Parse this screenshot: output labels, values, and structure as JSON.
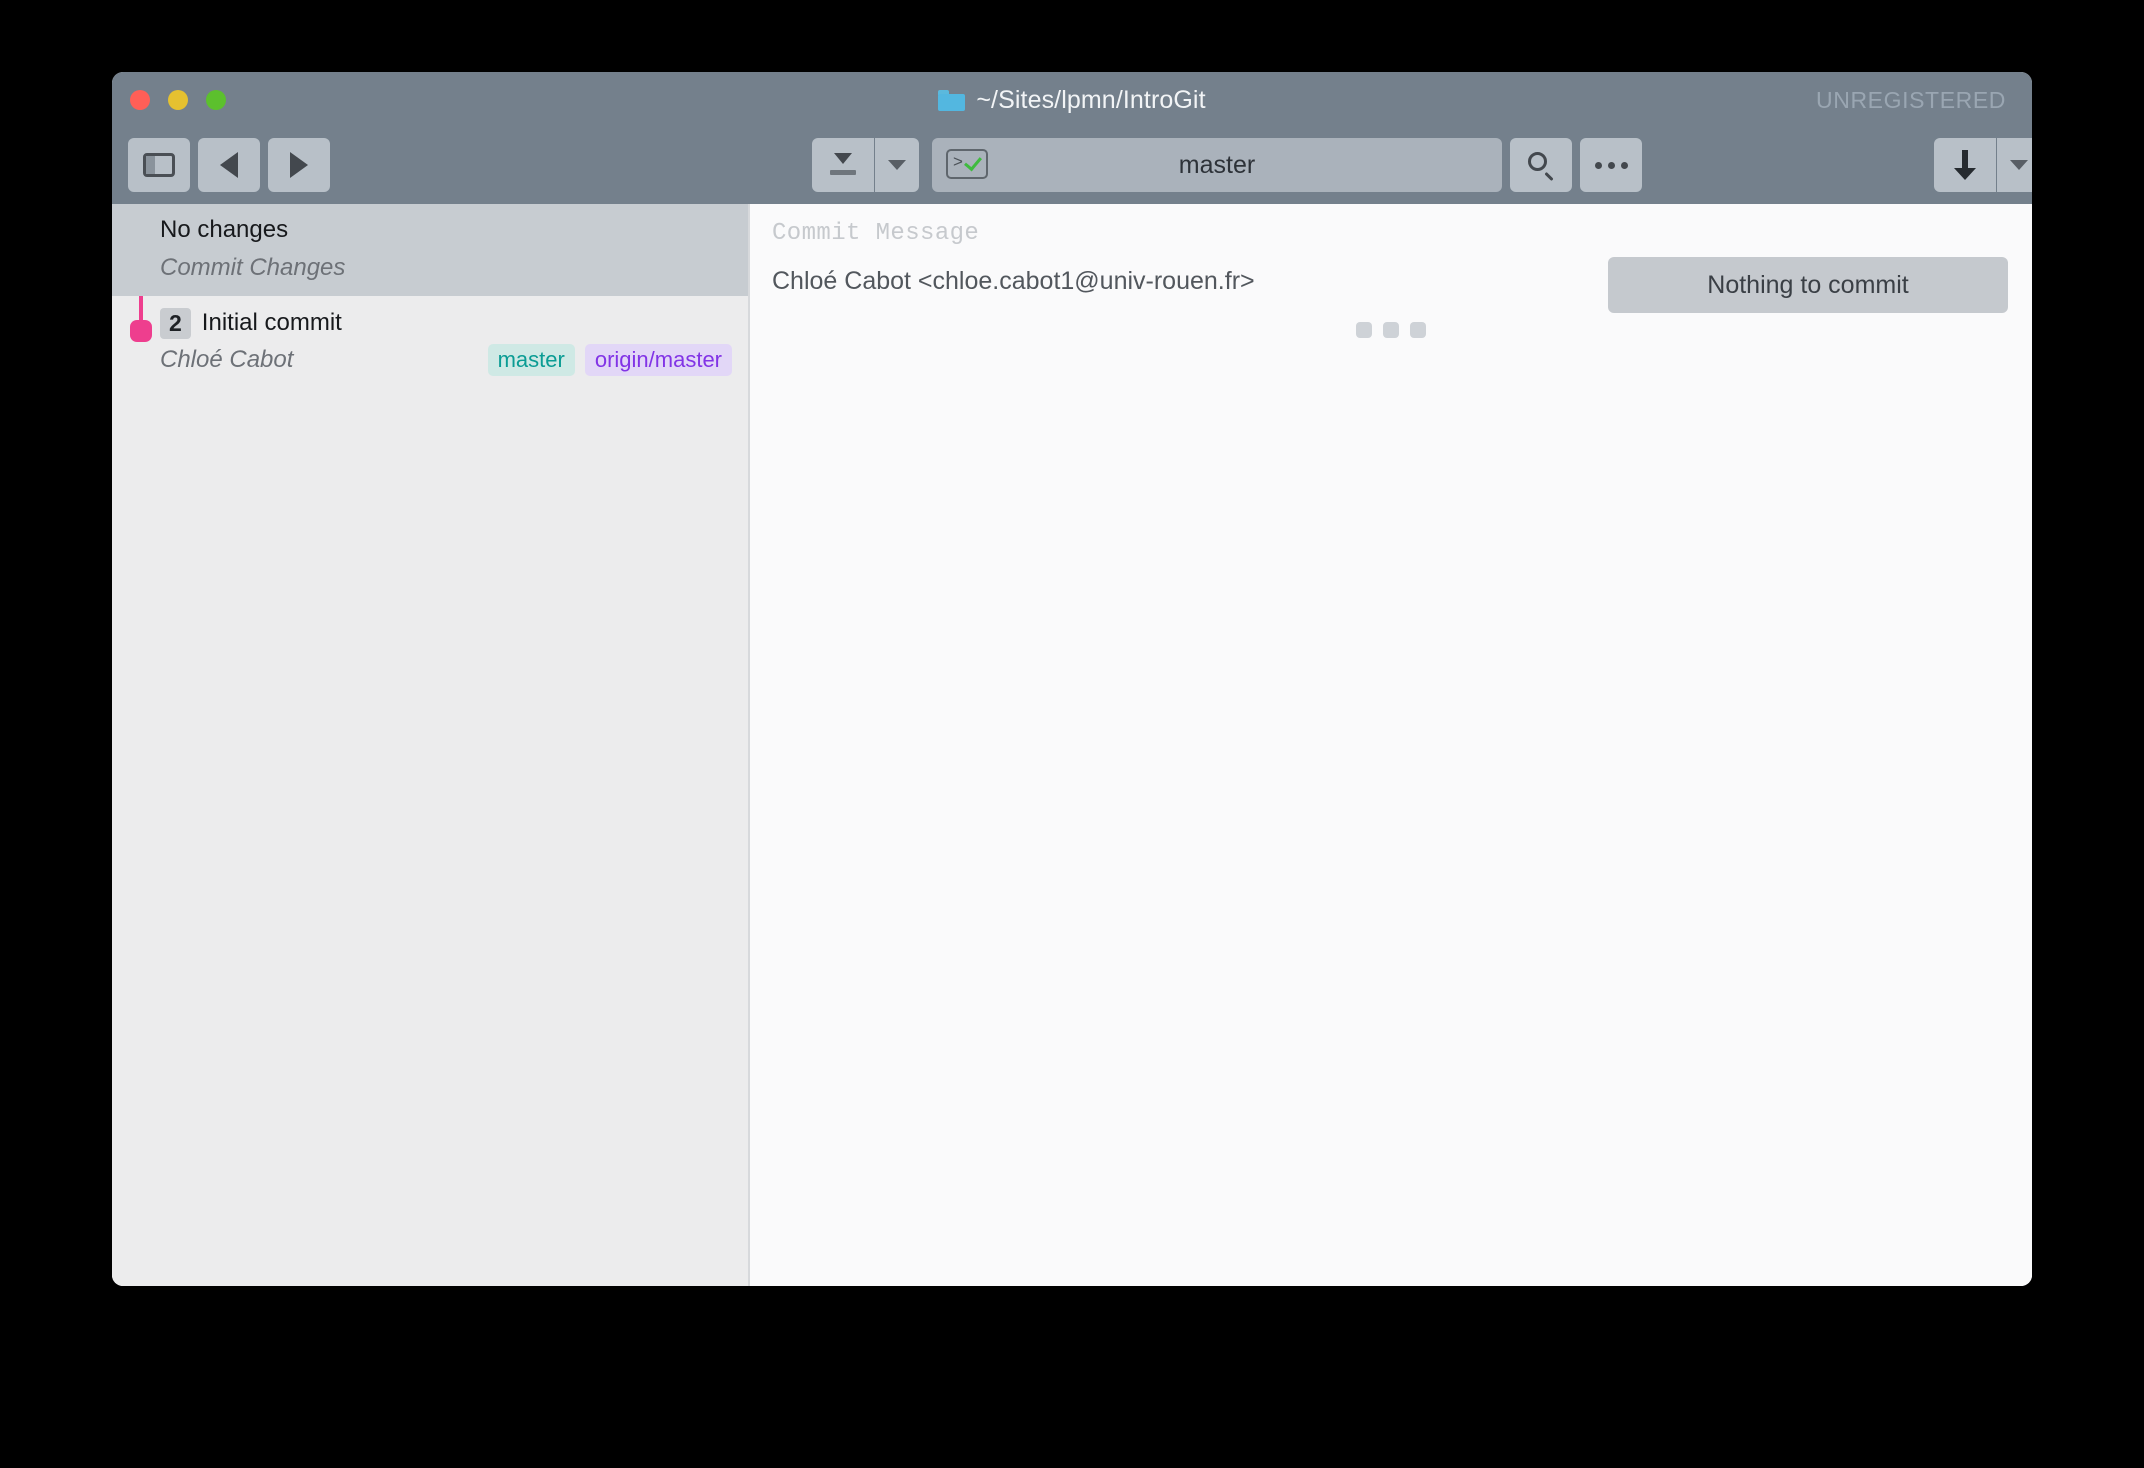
{
  "window": {
    "title": "~/Sites/lpmn/IntroGit",
    "registration_status": "UNREGISTERED",
    "traffic_lights": {
      "close": "close-button",
      "minimize": "minimize-button",
      "maximize": "maximize-button"
    }
  },
  "toolbar": {
    "sidebar_toggle": "sidebar-toggle",
    "back": "navigate-back",
    "forward": "navigate-forward",
    "stash": "stash-button",
    "stash_dropdown": "stash-dropdown",
    "branch": {
      "name": "master",
      "terminal_prompt": ">",
      "status": "ok"
    },
    "search": "search-button",
    "more": "more-options-button",
    "pull": "pull-button",
    "pull_dropdown": "pull-dropdown",
    "push": "push-button",
    "push_dropdown": "push-dropdown"
  },
  "sidebar": {
    "commits": [
      {
        "title": "No changes",
        "subtitle": "Commit Changes",
        "badge": "",
        "selected": true,
        "refs": []
      },
      {
        "title": "Initial commit",
        "subtitle": "Chloé Cabot",
        "badge": "2",
        "selected": false,
        "refs": [
          {
            "label": "master",
            "type": "local"
          },
          {
            "label": "origin/master",
            "type": "remote"
          }
        ]
      }
    ]
  },
  "main": {
    "commit_message_placeholder": "Commit Message",
    "author": "Chloé Cabot <chloe.cabot1@univ-rouen.fr>",
    "commit_button_label": "Nothing to commit"
  },
  "colors": {
    "titlebar": "#74808c",
    "graph_accent": "#ee3e8e",
    "local_ref_bg": "#cfe9e5",
    "local_ref_fg": "#0b9c94",
    "remote_ref_bg": "#e2d7f7",
    "remote_ref_fg": "#8234e6",
    "selection": "#c7ccd1"
  }
}
